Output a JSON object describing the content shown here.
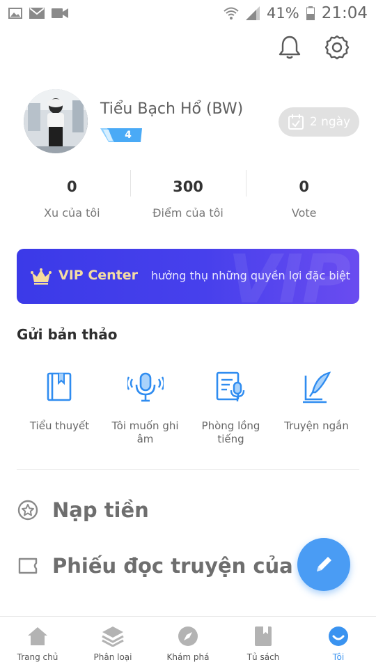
{
  "status_bar": {
    "battery": "41%",
    "time": "21:04"
  },
  "profile": {
    "username": "Tiểu Bạch Hổ (BW)",
    "level": "4",
    "checkin_label": "2 ngày"
  },
  "stats": [
    {
      "value": "0",
      "label": "Xu của tôi"
    },
    {
      "value": "300",
      "label": "Điểm của tôi"
    },
    {
      "value": "0",
      "label": "Vote"
    }
  ],
  "vip": {
    "title": "VIP Center",
    "subtitle": "hưởng thụ những quyền lợi đặc biệt",
    "watermark": "VIP"
  },
  "submit_section": {
    "title": "Gửi bản thảo",
    "items": [
      {
        "label": "Tiểu thuyết",
        "icon": "book-icon"
      },
      {
        "label": "Tôi muốn ghi âm",
        "icon": "microphone-icon"
      },
      {
        "label": "Phòng lồng tiếng",
        "icon": "dubbing-room-icon"
      },
      {
        "label": "Truyện ngắn",
        "icon": "feather-quill-icon"
      }
    ]
  },
  "menu": [
    {
      "label": "Nạp tiền",
      "icon": "star-circle-icon"
    },
    {
      "label": "Phiếu đọc truyện của tôi",
      "icon": "ticket-icon"
    }
  ],
  "bottom_nav": [
    {
      "label": "Trang chủ",
      "icon": "home-icon"
    },
    {
      "label": "Phân loại",
      "icon": "layers-icon"
    },
    {
      "label": "Khám phá",
      "icon": "compass-icon"
    },
    {
      "label": "Tủ sách",
      "icon": "bookshelf-icon"
    },
    {
      "label": "Tôi",
      "icon": "smile-icon",
      "active": true
    }
  ],
  "colors": {
    "accent": "#3a93f0",
    "icon_blue": "#2f8cf0",
    "vip_start": "#3b3ae8",
    "vip_end": "#6a4cf0",
    "vip_title": "#f3dca4",
    "fab": "#4a9cf4",
    "checkin_bg": "#e1e1e1"
  }
}
